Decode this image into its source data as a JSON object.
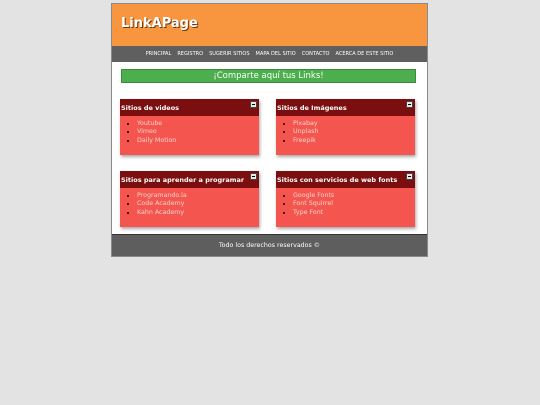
{
  "header": {
    "logo": "LinkAPage",
    "background_color": "#f7963f"
  },
  "nav": {
    "items": [
      {
        "label": "PRINCIPAL"
      },
      {
        "label": "REGISTRO"
      },
      {
        "label": "SUGERIR SITIOS"
      },
      {
        "label": "MAPA DEL SITIO"
      },
      {
        "label": "CONTACTO"
      },
      {
        "label": "ACERCA DE ESTE SITIO"
      }
    ]
  },
  "share_banner": {
    "label": "¡Comparte aquí tus Links!",
    "color": "#4cae4c"
  },
  "boxes": [
    {
      "title": "Sitios de videos",
      "links": [
        "Youtube",
        "Vimeo",
        "Daily Motion"
      ]
    },
    {
      "title": "Sitios de Imágenes",
      "links": [
        "Pixabay",
        "Unplash",
        "Freepik"
      ]
    },
    {
      "title": "Sitios para aprender a programar",
      "links": [
        "Programando.la",
        "Code Academy",
        "Kahn Academy"
      ]
    },
    {
      "title": "Sitios con servicios de web fonts",
      "links": [
        "Google Fonts",
        "Font Squirrel",
        "Type Font"
      ]
    }
  ],
  "footer": {
    "text": "Todo los derechos reservados ©"
  },
  "colors": {
    "box_header": "#7b0f0f",
    "box_body": "#f4564f",
    "nav_bar": "#5f5f5f",
    "footer_bar": "#5e5e5e"
  }
}
